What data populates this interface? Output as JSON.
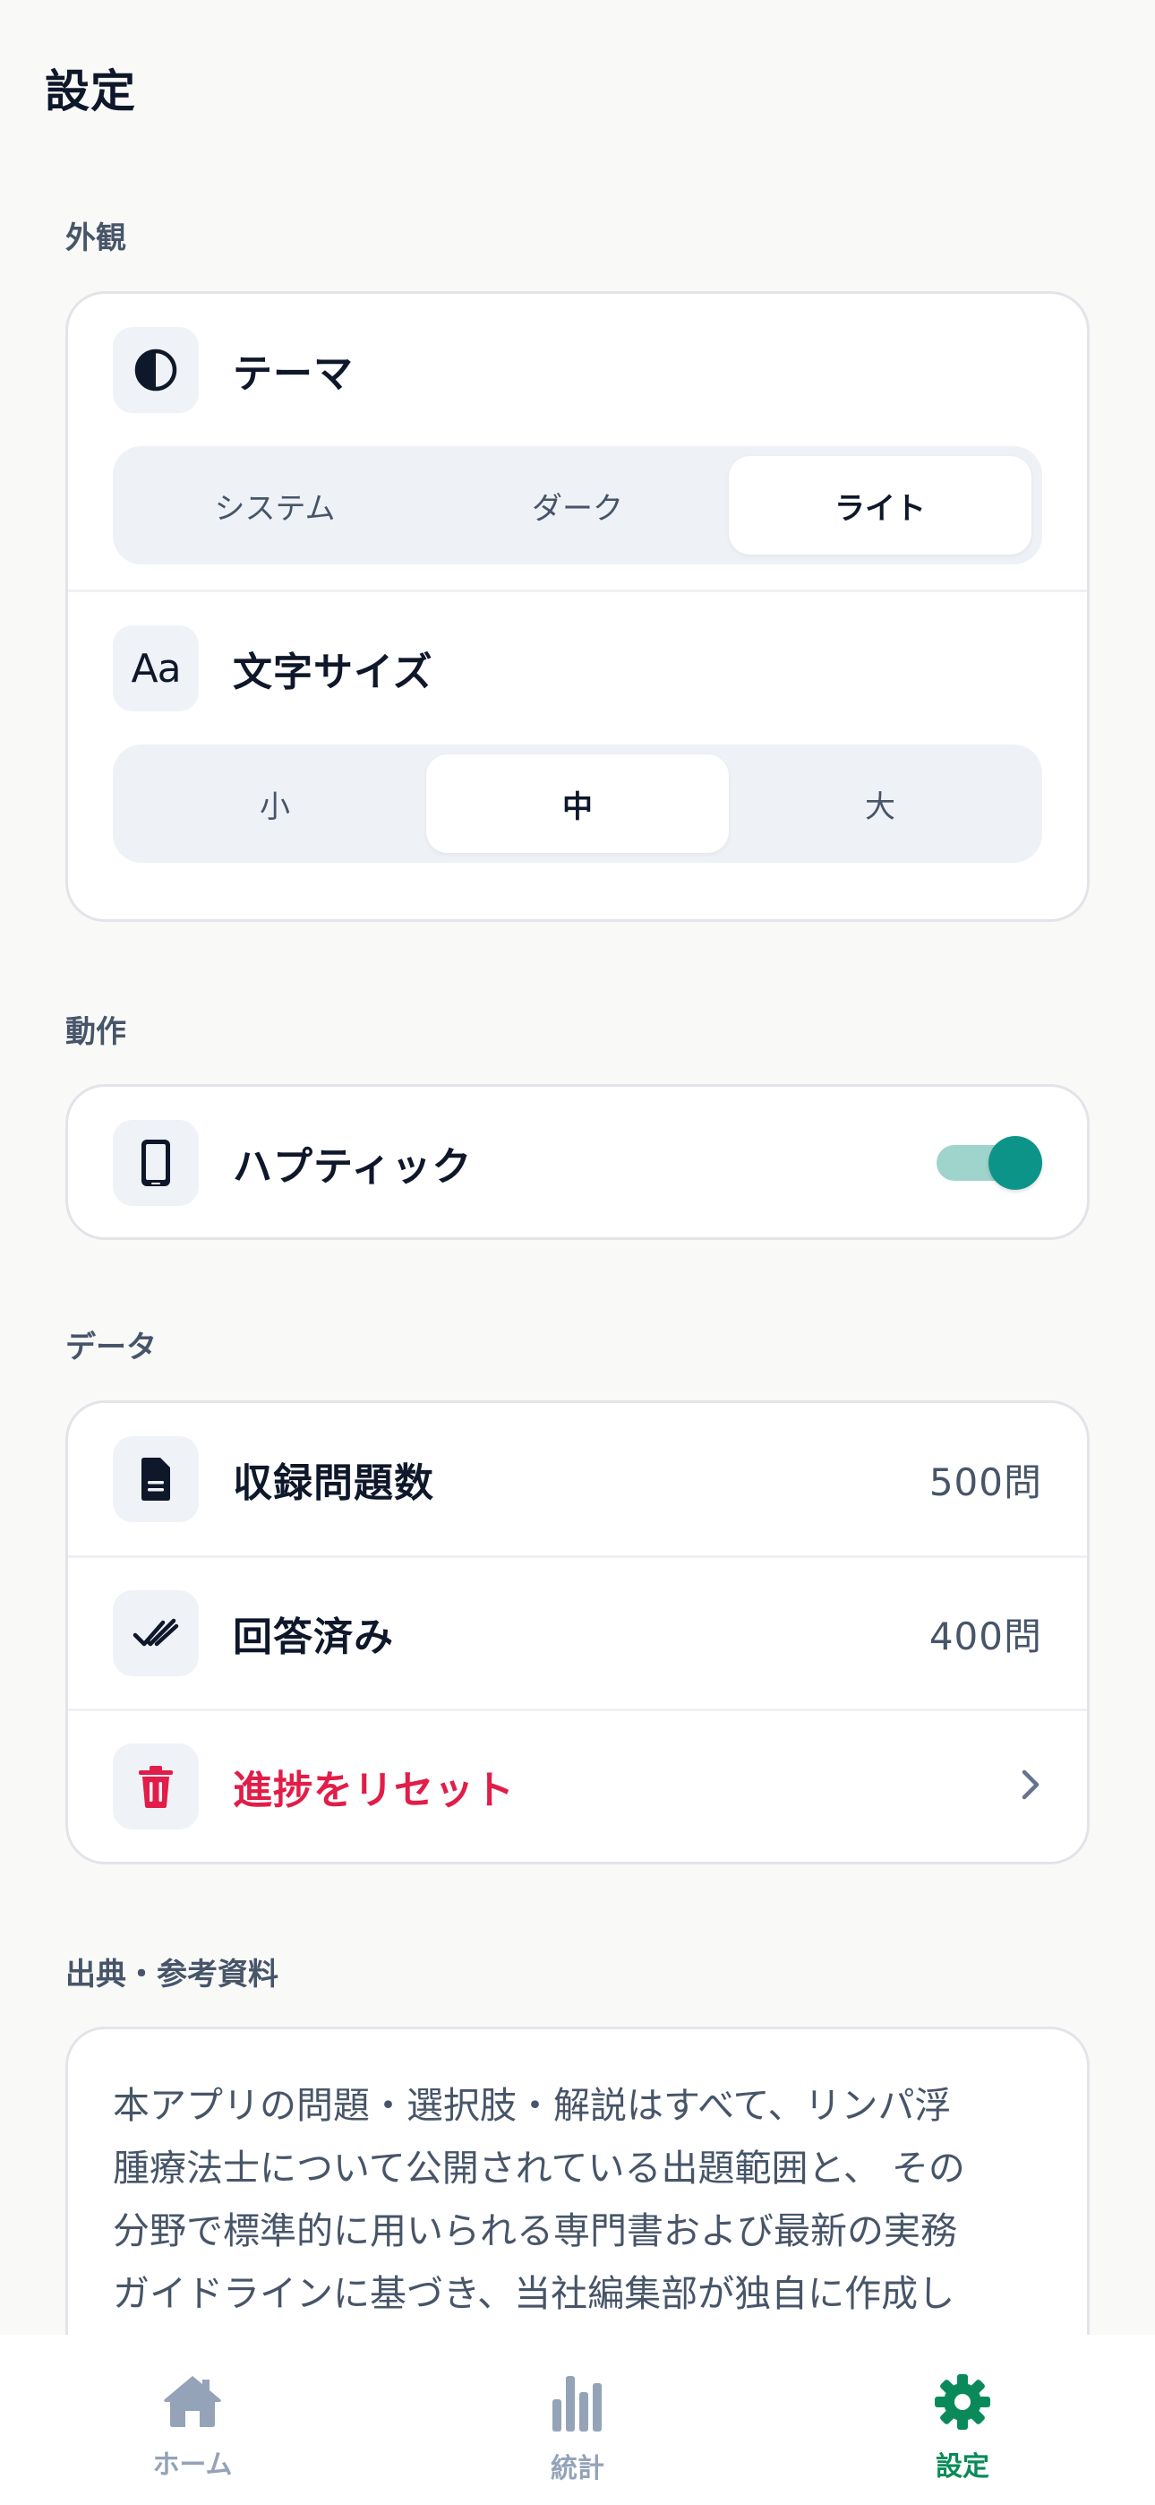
{
  "header": {
    "title": "設定"
  },
  "sections": {
    "appearance": {
      "label": "外観",
      "theme": {
        "title": "テーマ",
        "icon": "contrast-icon",
        "options": [
          "システム",
          "ダーク",
          "ライト"
        ],
        "selected": "ライト"
      },
      "font_size": {
        "title": "文字サイズ",
        "icon_text": "Aa",
        "options": [
          "小",
          "中",
          "大"
        ],
        "selected": "中"
      }
    },
    "behavior": {
      "label": "動作",
      "haptic": {
        "title": "ハプティック",
        "icon": "phone-icon",
        "enabled": true
      }
    },
    "data": {
      "label": "データ",
      "rows": [
        {
          "title": "収録問題数",
          "value": "500問",
          "icon": "document-icon"
        },
        {
          "title": "回答済み",
          "value": "400問",
          "icon": "double-check-icon"
        }
      ],
      "reset": {
        "title": "進捗をリセット",
        "icon": "trash-icon"
      }
    },
    "sources": {
      "label": "出典・参考資料",
      "lines": [
        "本アプリの問題・選択肢・解説はすべて、リンパ浮",
        "腫療法士について公開されている出題範囲と、 その",
        "分野で標準的に用いられる専門書および最新の実務",
        "ガイドラインに基づき、当社編集部が独自に作成し"
      ]
    }
  },
  "tabbar": {
    "items": [
      {
        "label": "ホーム",
        "icon": "home-icon"
      },
      {
        "label": "統計",
        "icon": "bar-chart-icon"
      },
      {
        "label": "設定",
        "icon": "gear-icon"
      }
    ],
    "active": "設定"
  },
  "colors": {
    "accent": "#0d9488",
    "active_tab": "#0a8a5a",
    "danger": "#e11d48",
    "inactive_tab": "#94a3b8"
  }
}
